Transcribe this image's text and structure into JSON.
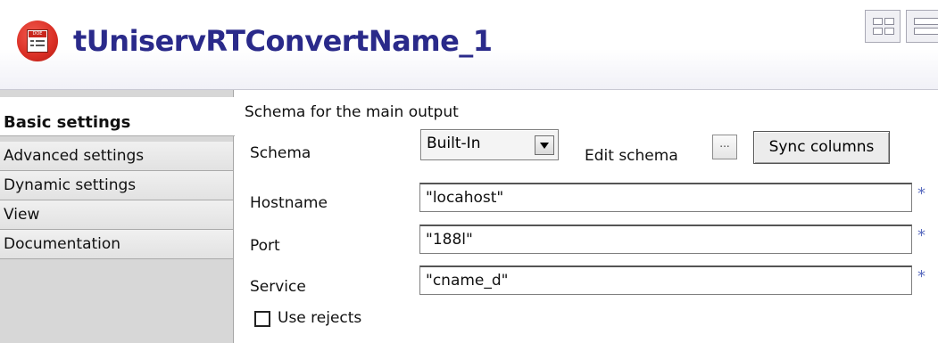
{
  "header": {
    "icon": "component-doc-icon",
    "icon_tag": "DOE",
    "title": "tUniservRTConvertName_1"
  },
  "tabs": [
    {
      "label": "Basic settings",
      "active": true
    },
    {
      "label": "Advanced settings",
      "active": false
    },
    {
      "label": "Dynamic settings",
      "active": false
    },
    {
      "label": "View",
      "active": false
    },
    {
      "label": "Documentation",
      "active": false
    }
  ],
  "main": {
    "section_title": "Schema for the main output",
    "schema_label": "Schema",
    "schema_value": "Built-In",
    "edit_schema_label": "Edit schema",
    "edit_schema_button": "...",
    "sync_columns_label": "Sync columns",
    "hostname_label": "Hostname",
    "hostname_value": "\"locahost\"",
    "port_label": "Port",
    "port_value": "\"188l\"",
    "service_label": "Service",
    "service_value": "\"cname_d\"",
    "required_marker": "*",
    "use_rejects_label": "Use rejects",
    "use_rejects_checked": false
  },
  "colors": {
    "title": "#2a2a8a",
    "icon": "#d92e24",
    "required": "#5a6cbf"
  }
}
